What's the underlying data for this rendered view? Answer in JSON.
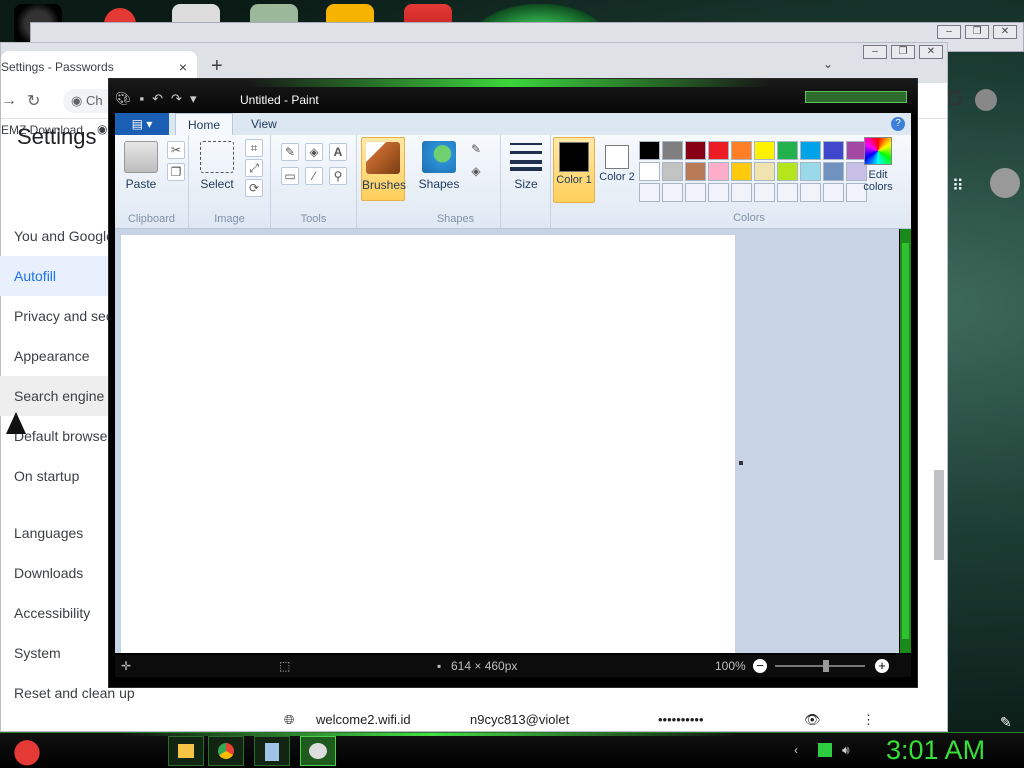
{
  "chrome": {
    "tab_title": "Settings - Passwords",
    "tab_close": "×",
    "new_tab": "+",
    "tab_menu": "⌄",
    "address_prefix": "Ch",
    "bookmark": "EMZ Download",
    "settings_title": "Settings",
    "sidebar": [
      {
        "label": "You and Google",
        "top": 0
      },
      {
        "label": "Autofill",
        "active": true
      },
      {
        "label": "Privacy and security"
      },
      {
        "label": "Appearance"
      },
      {
        "label": "Search engine"
      },
      {
        "label": "Default browser"
      },
      {
        "label": "On startup"
      },
      {
        "label": "Languages"
      },
      {
        "label": "Downloads"
      },
      {
        "label": "Accessibility"
      },
      {
        "label": "System"
      },
      {
        "label": "Reset and clean up"
      }
    ],
    "password_row": {
      "site": "welcome2.wifi.id",
      "username": "n9cyc813@violet",
      "password": "••••••••••"
    }
  },
  "paint": {
    "title": "Untitled - Paint",
    "tabs": {
      "home": "Home",
      "view": "View"
    },
    "help": "?",
    "groups": {
      "clipboard": "Clipboard",
      "image": "Image",
      "tools": "Tools",
      "shapes": "Shapes",
      "colors": "Colors"
    },
    "buttons": {
      "paste": "Paste",
      "select": "Select",
      "brushes": "Brushes",
      "shapes": "Shapes",
      "size": "Size",
      "color1": "Color 1",
      "color2": "Color 2",
      "edit_colors": "Edit colors"
    },
    "palette": [
      "#000000",
      "#7f7f7f",
      "#880015",
      "#ed1c24",
      "#ff7f27",
      "#fff200",
      "#22b14c",
      "#00a2e8",
      "#3f48cc",
      "#a349a4",
      "#ffffff",
      "#c3c3c3",
      "#b97a57",
      "#ffaec9",
      "#ffc90e",
      "#efe4b0",
      "#b5e61d",
      "#99d9ea",
      "#7092be",
      "#c8bfe7",
      "#f0f4fa",
      "#f0f4fa",
      "#f0f4fa",
      "#f0f4fa",
      "#f0f4fa",
      "#f0f4fa",
      "#f0f4fa",
      "#f0f4fa",
      "#f0f4fa",
      "#f0f4fa"
    ],
    "color1": "#000000",
    "color2": "#ffffff",
    "status": {
      "dimensions": "614 × 460px",
      "zoom": "100%"
    }
  },
  "taskbar": {
    "clock": "3:01 AM"
  }
}
